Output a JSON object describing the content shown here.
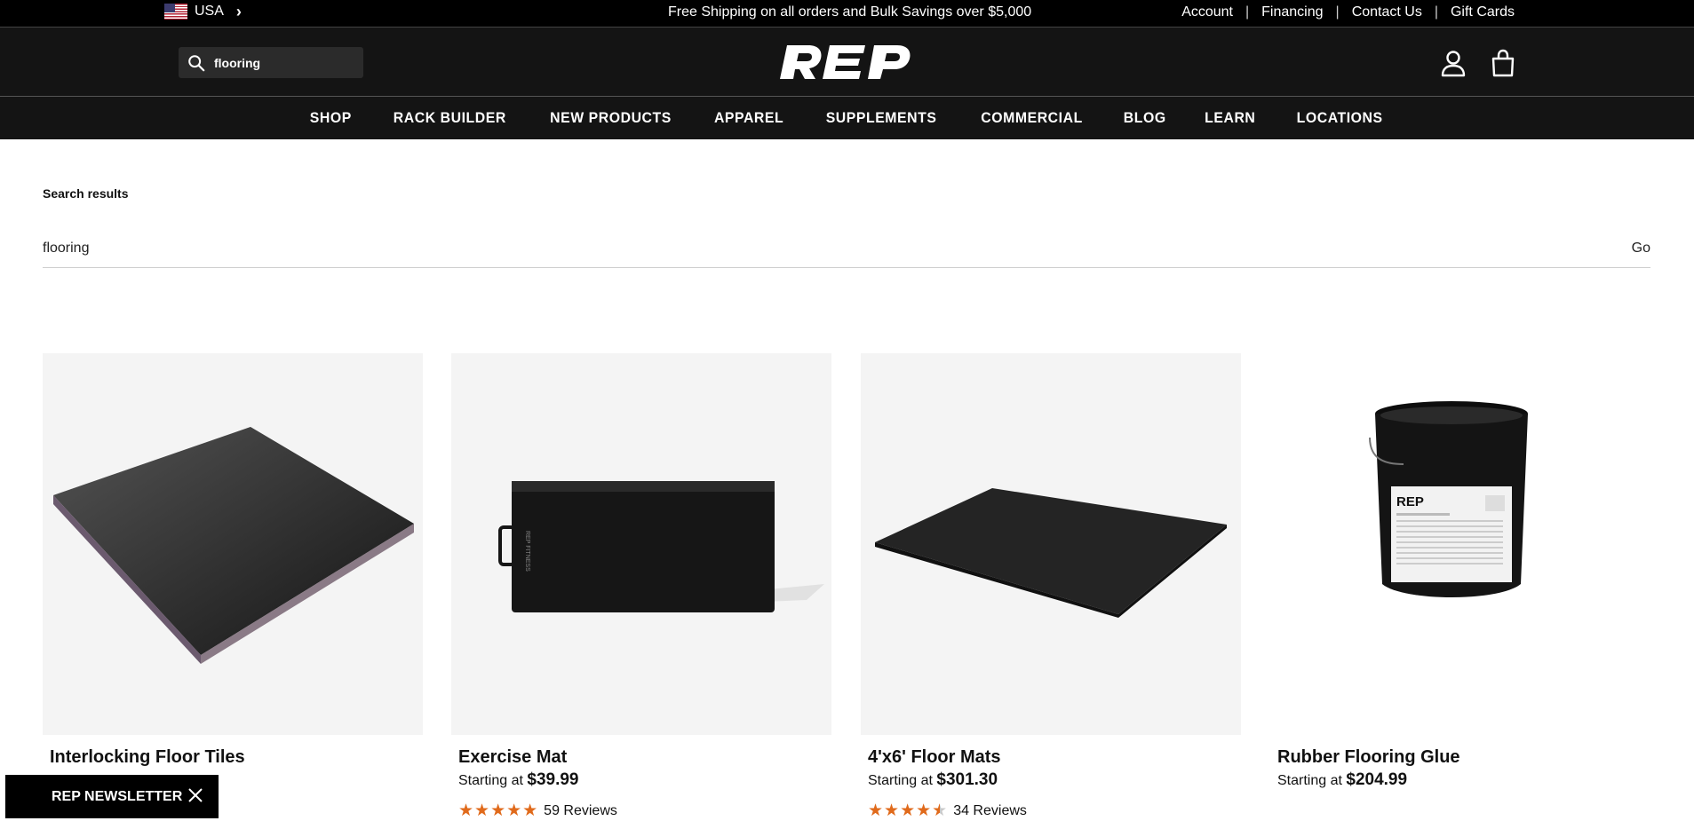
{
  "topbar": {
    "country": "USA",
    "promo": "Free Shipping on all orders and Bulk Savings over $5,000",
    "links": [
      "Account",
      "Financing",
      "Contact Us",
      "Gift Cards"
    ],
    "separator": "|"
  },
  "header": {
    "search_value": "flooring",
    "logo_text": "REP",
    "icons": [
      "search-icon",
      "account-icon",
      "cart-icon"
    ]
  },
  "nav": {
    "items": [
      "SHOP",
      "RACK BUILDER",
      "NEW PRODUCTS",
      "APPAREL",
      "SUPPLEMENTS",
      "COMMERCIAL",
      "BLOG",
      "LEARN",
      "LOCATIONS"
    ]
  },
  "results": {
    "title": "Search results",
    "query": "flooring",
    "go_label": "Go"
  },
  "products": [
    {
      "name": "Interlocking Floor Tiles"
    },
    {
      "name": "Exercise Mat",
      "price_prefix": "Starting at",
      "price": "$39.99",
      "rating": 5,
      "reviews": "59 Reviews"
    },
    {
      "name": "4'x6' Floor Mats",
      "price_prefix": "Starting at",
      "price": "$301.30",
      "rating": 4.5,
      "reviews": "34 Reviews"
    },
    {
      "name": "Rubber Flooring Glue",
      "price_prefix": "Starting at",
      "price": "$204.99"
    }
  ],
  "newsletter": {
    "label": "REP NEWSLETTER"
  },
  "colors": {
    "star": "#e06a1b",
    "header_bg": "#141414"
  }
}
